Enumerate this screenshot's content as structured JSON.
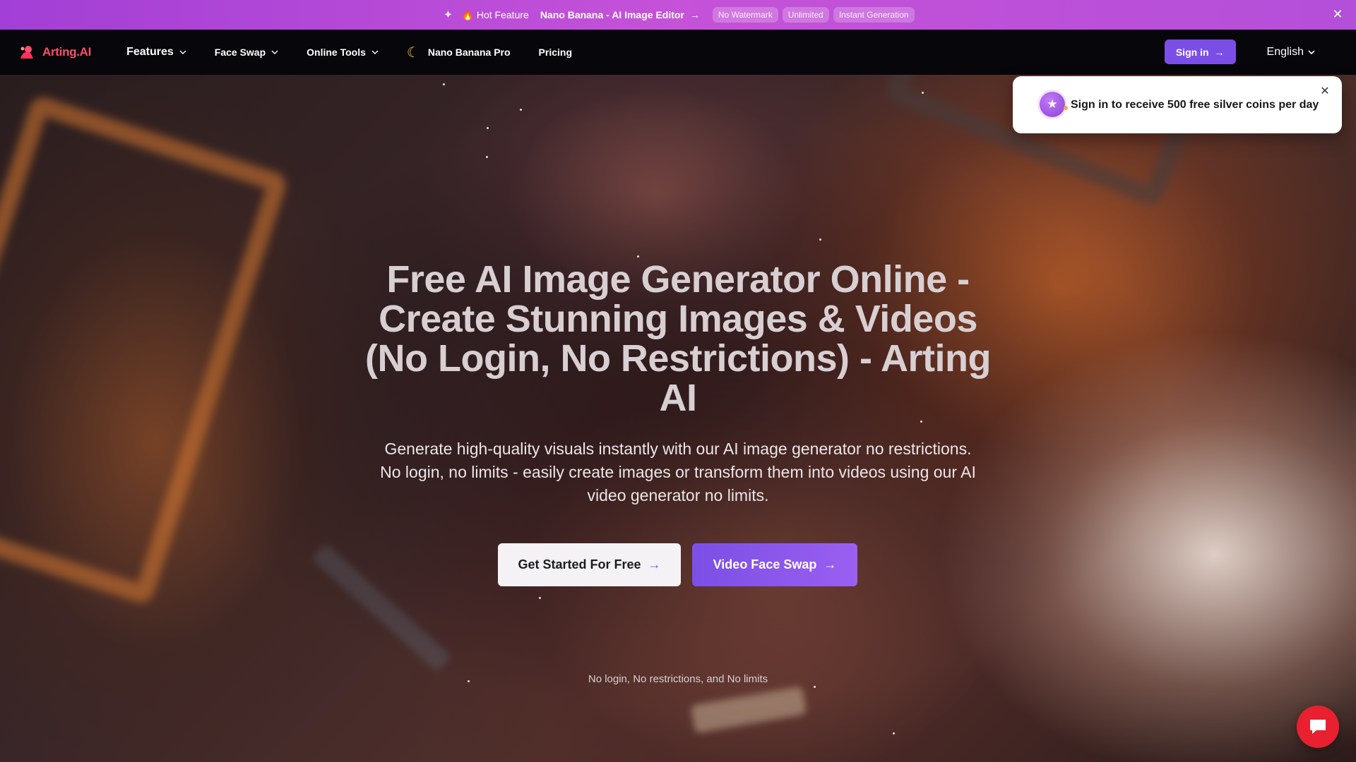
{
  "promo": {
    "hot_label": "Hot Feature",
    "feature_label": "Nano Banana - AI Image Editor",
    "pills": [
      "No Watermark",
      "Unlimited",
      "Instant Generation"
    ]
  },
  "nav": {
    "logo_text": "Arting.AI",
    "menu": {
      "features": "Features",
      "face_swap": "Face Swap",
      "online_tools": "Online Tools",
      "nano_banana_pro": "Nano Banana Pro",
      "pricing": "Pricing"
    },
    "sign_in": "Sign in",
    "language": "English"
  },
  "toast": {
    "message": "Sign in to receive 500 free silver coins per day"
  },
  "hero": {
    "title": "Free AI Image Generator Online - Create Stunning Images & Videos (No Login, No Restrictions) - Arting AI",
    "subtitle": "Generate high-quality visuals instantly with our AI image generator no restrictions. No login, no limits - easily create images or transform them into videos using our AI video generator no limits.",
    "cta_primary": "Get Started For Free",
    "cta_secondary": "Video Face Swap",
    "note": "No login, No restrictions, and No limits"
  },
  "colors": {
    "accent_purple": "#7b4fe6",
    "promo_bg": "#b44fd9",
    "logo": "#ff4d6d",
    "chat": "#e8202f"
  },
  "icons": [
    "sparkle-icon",
    "fire-icon",
    "arrow-right-icon",
    "close-icon",
    "chevron-down-icon",
    "moon-icon",
    "star-icon",
    "chat-icon"
  ]
}
